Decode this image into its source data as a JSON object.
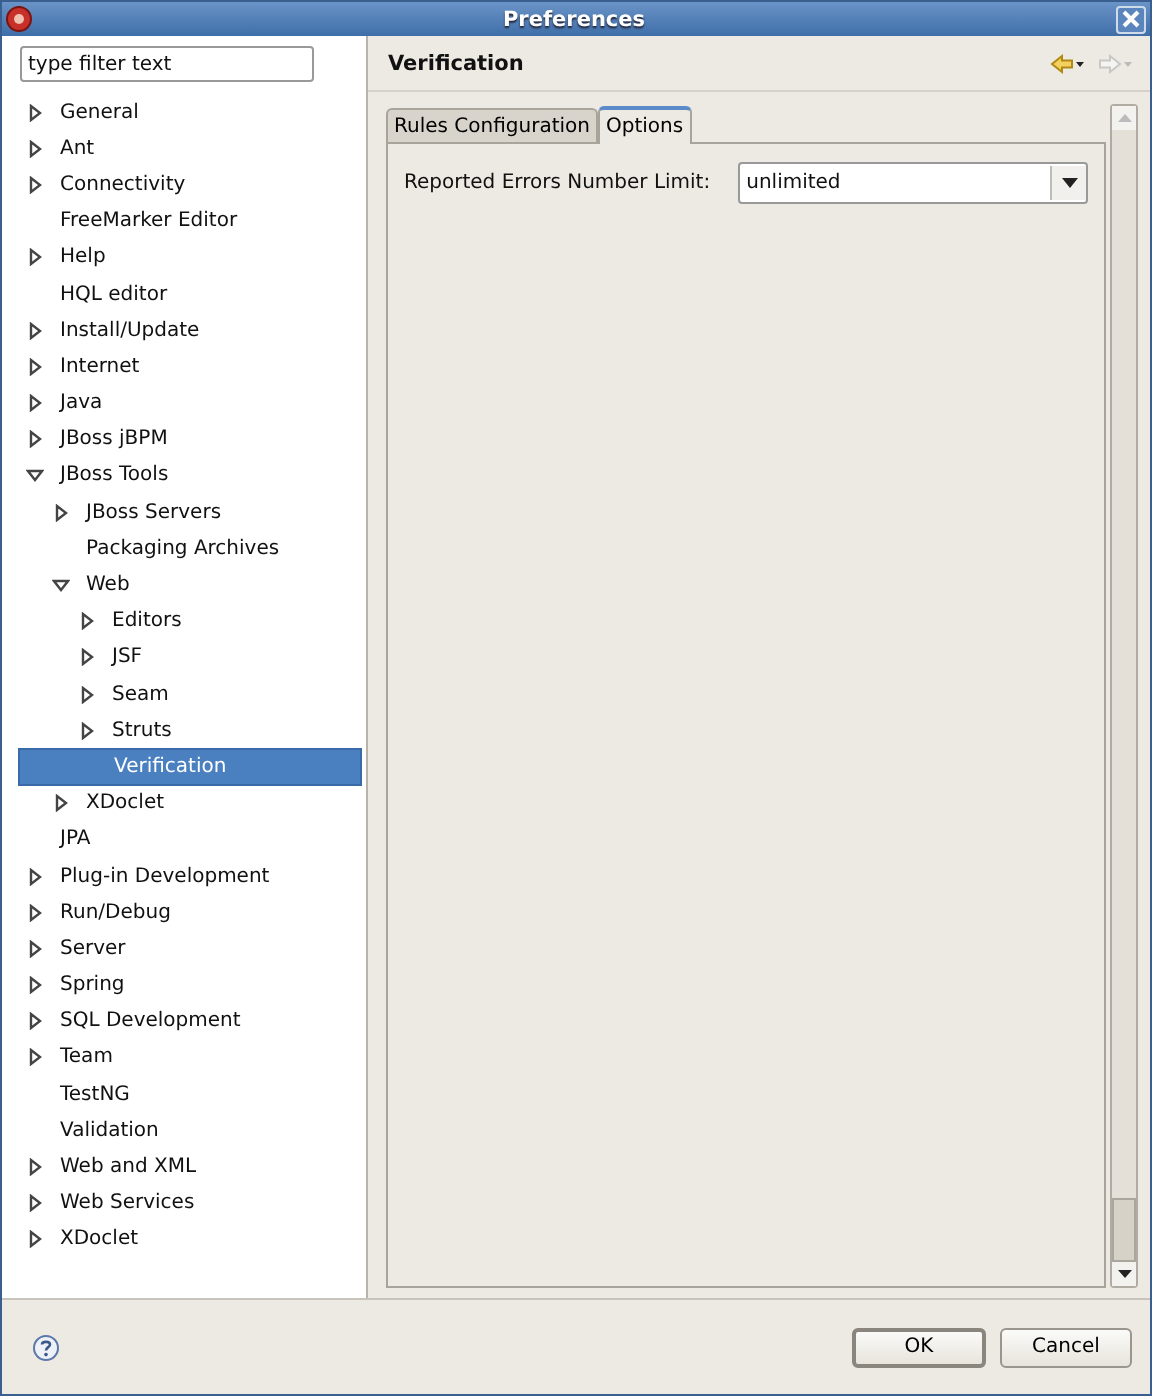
{
  "window": {
    "title": "Preferences"
  },
  "filter": {
    "placeholder": "type filter text"
  },
  "tree": [
    {
      "label": "General",
      "expanded": false,
      "selected": false
    },
    {
      "label": "Ant",
      "expanded": false,
      "selected": false
    },
    {
      "label": "Connectivity",
      "expanded": false,
      "selected": false
    },
    {
      "label": "FreeMarker Editor",
      "selected": false
    },
    {
      "label": "Help",
      "expanded": false,
      "selected": false
    },
    {
      "label": "HQL editor",
      "selected": false
    },
    {
      "label": "Install/Update",
      "expanded": false,
      "selected": false
    },
    {
      "label": "Internet",
      "expanded": false,
      "selected": false
    },
    {
      "label": "Java",
      "expanded": false,
      "selected": false
    },
    {
      "label": "JBoss jBPM",
      "expanded": false,
      "selected": false
    },
    {
      "label": "JBoss Tools",
      "expanded": true,
      "selected": false,
      "children": [
        {
          "label": "JBoss Servers",
          "expanded": false,
          "selected": false
        },
        {
          "label": "Packaging Archives",
          "selected": false
        },
        {
          "label": "Web",
          "expanded": true,
          "selected": false,
          "children": [
            {
              "label": "Editors",
              "expanded": false,
              "selected": false
            },
            {
              "label": "JSF",
              "expanded": false,
              "selected": false
            },
            {
              "label": "Seam",
              "expanded": false,
              "selected": false
            },
            {
              "label": "Struts",
              "expanded": false,
              "selected": false
            },
            {
              "label": "Verification",
              "selected": true
            }
          ]
        },
        {
          "label": "XDoclet",
          "expanded": false,
          "selected": false
        }
      ]
    },
    {
      "label": "JPA",
      "selected": false
    },
    {
      "label": "Plug-in Development",
      "expanded": false,
      "selected": false
    },
    {
      "label": "Run/Debug",
      "expanded": false,
      "selected": false
    },
    {
      "label": "Server",
      "expanded": false,
      "selected": false
    },
    {
      "label": "Spring",
      "expanded": false,
      "selected": false
    },
    {
      "label": "SQL Development",
      "expanded": false,
      "selected": false
    },
    {
      "label": "Team",
      "expanded": false,
      "selected": false
    },
    {
      "label": "TestNG",
      "selected": false
    },
    {
      "label": "Validation",
      "selected": false
    },
    {
      "label": "Web and XML",
      "expanded": false,
      "selected": false
    },
    {
      "label": "Web Services",
      "expanded": false,
      "selected": false
    },
    {
      "label": "XDoclet",
      "expanded": false,
      "selected": false
    }
  ],
  "page": {
    "title": "Verification"
  },
  "tabs": [
    {
      "label": "Rules Configuration",
      "selected": false
    },
    {
      "label": "Options",
      "selected": true
    }
  ],
  "fields": [
    {
      "label": "Reported Errors Number Limit:",
      "value": "unlimited"
    }
  ],
  "buttons": [
    {
      "label": "OK",
      "kind": "default"
    },
    {
      "label": "Cancel",
      "kind": "normal"
    }
  ]
}
